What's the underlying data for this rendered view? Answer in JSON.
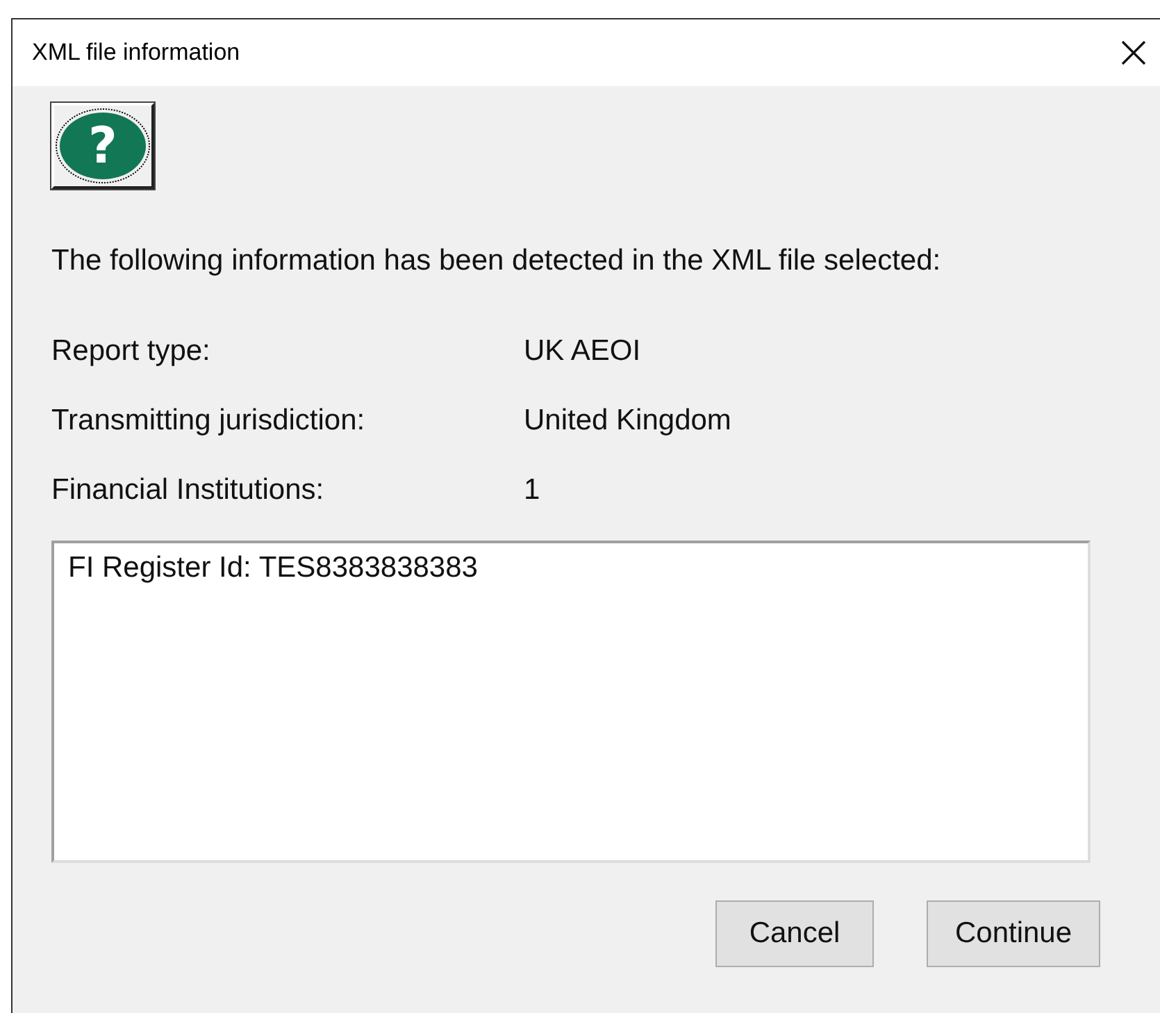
{
  "window": {
    "title": "XML file information"
  },
  "help_button": {
    "glyph": "?"
  },
  "intro": "The following information has been detected in the XML file selected:",
  "fields": [
    {
      "label": "Report type:",
      "value": "UK AEOI"
    },
    {
      "label": "Transmitting jurisdiction:",
      "value": "United Kingdom"
    },
    {
      "label": "Financial Institutions:",
      "value": "1"
    }
  ],
  "list": {
    "items": [
      "FI Register Id: TES8383838383"
    ]
  },
  "buttons": [
    "Cancel",
    "Continue"
  ]
}
